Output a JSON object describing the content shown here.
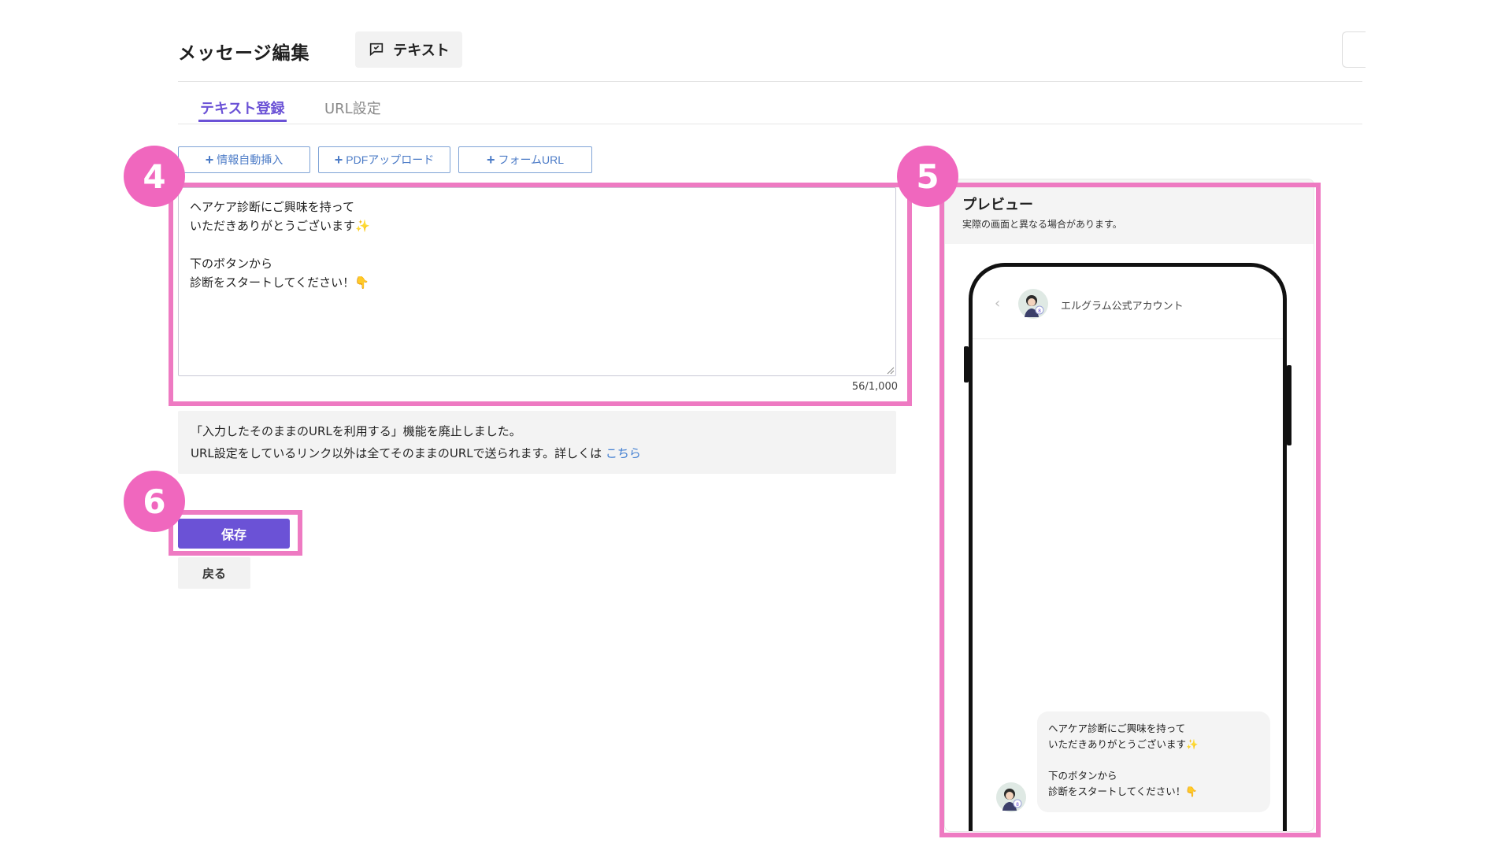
{
  "header": {
    "title": "メッセージ編集",
    "type_chip_label": "テキスト",
    "type_chip_icon": "chat-text-icon"
  },
  "tabs": [
    {
      "label": "テキスト登録",
      "active": true
    },
    {
      "label": "URL設定",
      "active": false
    }
  ],
  "toolbar": {
    "info_insert": "情報自動挿入",
    "pdf_upload": "PDFアップロード",
    "form_url": "フォームURL",
    "plus_icon": "plus-icon"
  },
  "editor": {
    "value": "ヘアケア診断にご興味を持って\nいただきありがとうございます✨\n\n下のボタンから\n診断をスタートしてください！👇",
    "counter": "56/1,000"
  },
  "notice": {
    "line1": "「入力したそのままのURLを利用する」機能を廃止しました。",
    "line2": "URL設定をしているリンク以外は全てそのままのURLで送られます。詳しくは",
    "link": "こちら"
  },
  "actions": {
    "save": "保存",
    "back": "戻る"
  },
  "annotations": {
    "badge_4": "4",
    "badge_5": "5",
    "badge_6": "6",
    "highlight_color": "#ee7ac2"
  },
  "preview": {
    "title": "プレビュー",
    "subtitle": "実際の画面と異なる場合があります。",
    "account_name": "エルグラム公式アカウント",
    "back_icon": "chevron-left-icon",
    "message": "ヘアケア診断にご興味を持って\nいただきありがとうございます✨\n\n下のボタンから\n診断をスタートしてください！👇"
  },
  "colors": {
    "accent": "#6b52d6",
    "link": "#3f7dd1",
    "tool_button": "#4d7cc7",
    "badge": "#f067be"
  }
}
